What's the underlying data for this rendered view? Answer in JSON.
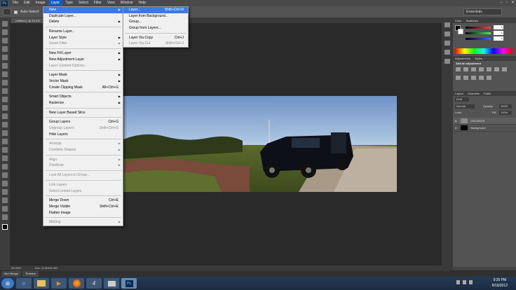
{
  "app": {
    "logo_text": "Ps"
  },
  "menubar": [
    "File",
    "Edit",
    "Image",
    "Layer",
    "Type",
    "Select",
    "Filter",
    "View",
    "Window",
    "Help"
  ],
  "options_bar": {
    "auto_select_label": "Auto-Select:",
    "workspace": "Essentials"
  },
  "document": {
    "tab_title": "Untitled-1 @ 33.3%"
  },
  "status_bar": {
    "zoom": "33.33%",
    "doc_info": "Doc: 11.9M/11.9M"
  },
  "bottom_tabs": [
    "Mini Bridge",
    "Timeline"
  ],
  "layer_menu": {
    "items": [
      {
        "label": "New",
        "shortcut": "",
        "submenu": true,
        "disabled": false,
        "highlight": true
      },
      {
        "label": "Duplicate Layer...",
        "shortcut": "",
        "submenu": false,
        "disabled": false
      },
      {
        "label": "Delete",
        "shortcut": "",
        "submenu": true,
        "disabled": false
      },
      {
        "sep": true
      },
      {
        "label": "Rename Layer...",
        "shortcut": "",
        "submenu": false,
        "disabled": false
      },
      {
        "label": "Layer Style",
        "shortcut": "",
        "submenu": true,
        "disabled": false
      },
      {
        "label": "Smart Filter",
        "shortcut": "",
        "submenu": true,
        "disabled": true
      },
      {
        "sep": true
      },
      {
        "label": "New Fill Layer",
        "shortcut": "",
        "submenu": true,
        "disabled": false
      },
      {
        "label": "New Adjustment Layer",
        "shortcut": "",
        "submenu": true,
        "disabled": false
      },
      {
        "label": "Layer Content Options...",
        "shortcut": "",
        "submenu": false,
        "disabled": true
      },
      {
        "sep": true
      },
      {
        "label": "Layer Mask",
        "shortcut": "",
        "submenu": true,
        "disabled": false
      },
      {
        "label": "Vector Mask",
        "shortcut": "",
        "submenu": true,
        "disabled": false
      },
      {
        "label": "Create Clipping Mask",
        "shortcut": "Alt+Ctrl+G",
        "submenu": false,
        "disabled": false
      },
      {
        "sep": true
      },
      {
        "label": "Smart Objects",
        "shortcut": "",
        "submenu": true,
        "disabled": false
      },
      {
        "label": "Rasterize",
        "shortcut": "",
        "submenu": true,
        "disabled": false
      },
      {
        "sep": true
      },
      {
        "label": "New Layer Based Slice",
        "shortcut": "",
        "submenu": false,
        "disabled": false
      },
      {
        "sep": true
      },
      {
        "label": "Group Layers",
        "shortcut": "Ctrl+G",
        "submenu": false,
        "disabled": false
      },
      {
        "label": "Ungroup Layers",
        "shortcut": "Shift+Ctrl+G",
        "submenu": false,
        "disabled": true
      },
      {
        "label": "Hide Layers",
        "shortcut": "",
        "submenu": false,
        "disabled": false
      },
      {
        "sep": true
      },
      {
        "label": "Arrange",
        "shortcut": "",
        "submenu": true,
        "disabled": true
      },
      {
        "label": "Combine Shapes",
        "shortcut": "",
        "submenu": true,
        "disabled": true
      },
      {
        "sep": true
      },
      {
        "label": "Align",
        "shortcut": "",
        "submenu": true,
        "disabled": true
      },
      {
        "label": "Distribute",
        "shortcut": "",
        "submenu": true,
        "disabled": true
      },
      {
        "sep": true
      },
      {
        "label": "Lock All Layers in Group...",
        "shortcut": "",
        "submenu": false,
        "disabled": true
      },
      {
        "sep": true
      },
      {
        "label": "Link Layers",
        "shortcut": "",
        "submenu": false,
        "disabled": true
      },
      {
        "label": "Select Linked Layers",
        "shortcut": "",
        "submenu": false,
        "disabled": true
      },
      {
        "sep": true
      },
      {
        "label": "Merge Down",
        "shortcut": "Ctrl+E",
        "submenu": false,
        "disabled": false
      },
      {
        "label": "Merge Visible",
        "shortcut": "Shift+Ctrl+E",
        "submenu": false,
        "disabled": false
      },
      {
        "label": "Flatten Image",
        "shortcut": "",
        "submenu": false,
        "disabled": false
      },
      {
        "sep": true
      },
      {
        "label": "Matting",
        "shortcut": "",
        "submenu": true,
        "disabled": true
      }
    ]
  },
  "new_submenu": {
    "items": [
      {
        "label": "Layer...",
        "shortcut": "Shift+Ctrl+N",
        "disabled": false,
        "highlight": true
      },
      {
        "label": "Layer from Background...",
        "shortcut": "",
        "disabled": false
      },
      {
        "label": "Group...",
        "shortcut": "",
        "disabled": false
      },
      {
        "label": "Group from Layers...",
        "shortcut": "",
        "disabled": false
      },
      {
        "sep": true
      },
      {
        "label": "Layer Via Copy",
        "shortcut": "Ctrl+J",
        "disabled": false
      },
      {
        "label": "Layer Via Cut",
        "shortcut": "Shift+Ctrl+J",
        "disabled": true
      }
    ]
  },
  "color_panel": {
    "tabs": [
      "Color",
      "Swatches"
    ],
    "values": [
      "1",
      "1",
      "1"
    ],
    "slider_colors": [
      "#ff4040",
      "#40ff40",
      "#4060ff"
    ]
  },
  "adjustments_panel": {
    "tabs": [
      "Adjustments",
      "Styles"
    ],
    "heading": "Add an adjustment"
  },
  "layers_panel": {
    "tabs": [
      "Layers",
      "Channels",
      "Paths"
    ],
    "kind": "Kind",
    "blend_mode": "Normal",
    "opacity_label": "Opacity:",
    "opacity_value": "100%",
    "lock_label": "Lock:",
    "fill_label": "Fill:",
    "fill_value": "100%",
    "layers": [
      {
        "name": "DSC00029"
      },
      {
        "name": "Background"
      }
    ]
  },
  "taskbar": {
    "apps": [
      "start",
      "ie",
      "explorer",
      "media",
      "firefox",
      "app4",
      "window",
      "photoshop"
    ],
    "time": "9:25 PM",
    "date": "8/16/2012"
  }
}
